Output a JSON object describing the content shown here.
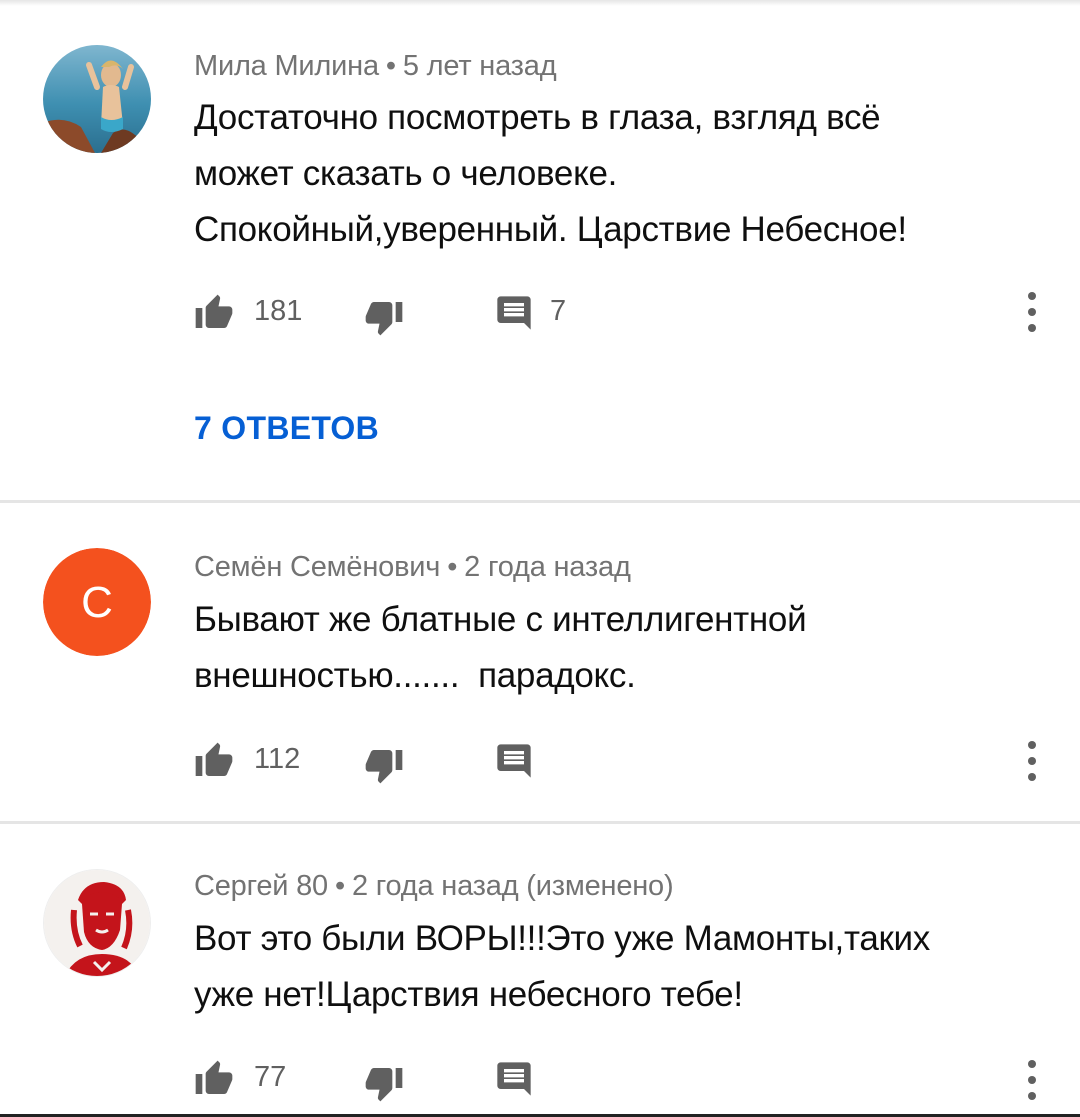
{
  "comments": [
    {
      "author": "Мила Милина",
      "time": "5 лет назад",
      "text_lines": [
        "Достаточно посмотреть в глаза, взгляд всё",
        "может сказать о человеке.",
        "Спокойный,уверенный. Царствие Небесное!"
      ],
      "likes": "181",
      "replies_count": "7",
      "replies_link": "7 ОТВЕТОВ",
      "avatar": "photo-avatar"
    },
    {
      "author": "Семён Семёнович",
      "time": "2 года назад",
      "text_lines": [
        "Бывают же блатные с интеллигентной",
        "внешностью.......  парадокс."
      ],
      "likes": "112",
      "replies_count": "",
      "avatar_letter": "С",
      "avatar_color": "#f4511e"
    },
    {
      "author": "Сергей 80",
      "time": "2 года назад (изменено)",
      "text_lines": [
        "Вот это были ВОРЫ!!!Это уже Мамонты,таких",
        "уже нет!Царствия небесного тебе!"
      ],
      "likes": "77",
      "replies_count": "",
      "avatar": "che-portrait-avatar"
    }
  ],
  "meta_separator": "•",
  "colors": {
    "link": "#065fd4",
    "meta": "#737373",
    "text": "#0f0f0f",
    "icon": "#606060"
  },
  "icons": {
    "like": "thumb-up-icon",
    "dislike": "thumb-down-icon",
    "reply": "comment-icon",
    "menu": "more-vert-icon"
  }
}
